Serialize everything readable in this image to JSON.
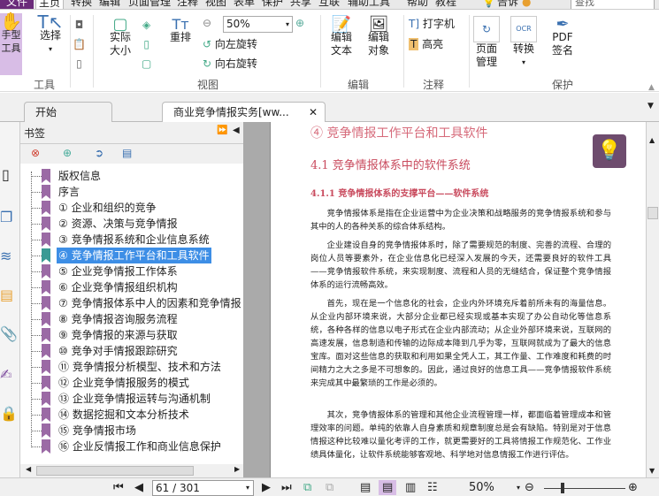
{
  "menu": {
    "file": "文件",
    "items": [
      "主页",
      "转换",
      "编辑",
      "页面管理",
      "注释",
      "视图",
      "表单",
      "保护",
      "共享",
      "互联",
      "辅助工具",
      "帮助",
      "教程"
    ],
    "tell": "告诉",
    "search_placeholder": "查找"
  },
  "ribbon": {
    "hand": "手型\n工具",
    "select": "选择",
    "tools_group": "工具",
    "actual_size": "实际\n大小",
    "reflow": "重排",
    "zoom_value": "50%",
    "rotate_left": "向左旋转",
    "rotate_right": "向右旋转",
    "view_group": "视图",
    "edit_text": "编辑\n文本",
    "edit_object": "编辑\n对象",
    "edit_group": "编辑",
    "typewriter": "打字机",
    "highlight": "高亮",
    "comment_group": "注释",
    "page_manage": "页面\n管理",
    "convert": "转换",
    "pdf_sign": "PDF\n签名",
    "protect_group": "保护"
  },
  "tabs": [
    {
      "label": "开始"
    },
    {
      "label": "商业竞争情报实务[ww..."
    }
  ],
  "bookmarks": {
    "title": "书签",
    "selected_index": 5,
    "items": [
      "版权信息",
      "序言",
      "① 企业和组织的竞争",
      "② 资源、决策与竞争情报",
      "③ 竞争情报系统和企业信息系统",
      "④ 竞争情报工作平台和工具软件",
      "⑤ 企业竞争情报工作体系",
      "⑥ 企业竞争情报组织机构",
      "⑦ 竞争情报体系中人的因素和竞争情报",
      "⑧ 竞争情报咨询服务流程",
      "⑨ 竞争情报的来源与获取",
      "⑩ 竞争对手情报跟踪研究",
      "⑪ 竞争情报分析模型、技术和方法",
      "⑫ 企业竞争情报服务的模式",
      "⑬ 企业竞争情报运转与沟通机制",
      "⑭ 数据挖掘和文本分析技术",
      "⑮ 竞争情报市场",
      "⑯ 企业反情报工作和商业信息保护"
    ]
  },
  "document": {
    "chapter": "④ 竞争情报工作平台和工具软件",
    "section": "4.1 竞争情报体系中的软件系统",
    "subsection": "4.1.1 竞争情报体系的支撑平台——软件系统",
    "paragraphs": [
      "竞争情报体系是指在企业运营中为企业决策和战略服务的竞争情报系统和参与其中的人的各种关系的综合体系结构。",
      "企业建设自身的竞争情报体系时，除了需要规范的制度、完善的流程、合理的岗位人员等要素外，在企业信息化已经深入发展的今天，还需要良好的软件工具——竞争情报软件系统，来实现制度、流程和人员的无缝结合，保证整个竞争情报体系的运行流畅高效。",
      "首先，现在是一个信息化的社会，企业内外环境充斥着前所未有的海量信息。从企业内部环境来说，大部分企业都已经实现或基本实现了办公自动化等信息系统，各种各样的信息以电子形式在企业内部流动；从企业外部环境来说，互联网的高速发展，信息制造和传输的边际成本降到几乎为零，互联网就成为了最大的信息宝库。面对这些信息的获取和利用如果全凭人工，其工作量、工作难度和耗费的时间精力之大之多是不可想象的。因此，通过良好的信息工具——竞争情报软件系统来完成其中最繁琐的工作是必须的。",
      "其次，竞争情报体系的管理和其他企业流程管理一样，都面临着管理成本和管理效率的问题。单纯的依靠人自身素质和规章制度总是会有缺陷。特别是对于信息情报这种比较难以量化考评的工作，就更需要好的工具将情报工作规范化、工作业绩具体量化，让软件系统能够客观地、科学地对信息情报工作进行评估。"
    ]
  },
  "status": {
    "page": "61 / 301",
    "zoom": "50%"
  },
  "colors": {
    "accent": "#6b2b7a",
    "selection": "#3d8ee6",
    "heading": "#c94b5e"
  }
}
